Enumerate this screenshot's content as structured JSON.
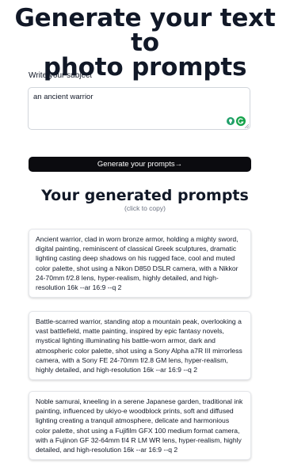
{
  "hero": {
    "title_line1": "Generate your text to",
    "title_line2": "photo prompts"
  },
  "form": {
    "subject_label": "Write your subject",
    "subject_value": "an ancient warrior",
    "generate_button": "Generate your prompts→"
  },
  "results": {
    "title": "Your generated prompts",
    "hint": "(click to copy)",
    "prompts": [
      "Ancient warrior, clad in worn bronze armor, holding a mighty sword, digital painting, reminiscent of classical Greek sculptures, dramatic lighting casting deep shadows on his rugged face, cool and muted color palette, shot using a Nikon D850 DSLR camera, with a Nikkor 24-70mm f/2.8 lens, hyper-realism, highly detailed, and high-resolution 16k --ar 16:9 --q 2",
      "Battle-scarred warrior, standing atop a mountain peak, overlooking a vast battlefield, matte painting, inspired by epic fantasy novels, mystical lighting illuminating his battle-worn armor, dark and atmospheric color palette, shot using a Sony Alpha a7R III mirrorless camera, with a Sony FE 24-70mm f/2.8 GM lens, hyper-realism, highly detailed, and high-resolution 16k --ar 16:9 --q 2",
      "Noble samurai, kneeling in a serene Japanese garden, traditional ink painting, influenced by ukiyo-e woodblock prints, soft and diffused lighting creating a tranquil atmosphere, delicate and harmonious color palette, shot using a Fujifilm GFX 100 medium format camera, with a Fujinon GF 32-64mm f/4 R LM WR lens, hyper-realism, highly detailed, and high-resolution 16k --ar 16:9 --q 2"
    ]
  },
  "icons": {
    "extension_1": "lightbulb-icon",
    "extension_2": "grammar-check-icon"
  },
  "colors": {
    "button_bg": "#0b0b0f",
    "title_text": "#111827",
    "hint_text": "#6b7280",
    "extension_green": "#15a34a"
  }
}
